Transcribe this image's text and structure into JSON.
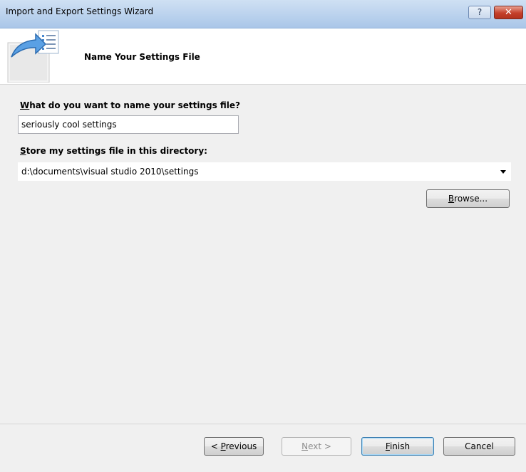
{
  "window": {
    "title": "Import and Export Settings Wizard",
    "help_label": "?",
    "close_label": "✕"
  },
  "header": {
    "heading": "Name Your Settings File"
  },
  "form": {
    "name_label_accel": "W",
    "name_label_rest": "hat do you want to name your settings file?",
    "name_value": "seriously cool settings",
    "dir_label_accel": "S",
    "dir_label_rest": "tore my settings file in this directory:",
    "dir_value": "d:\\documents\\visual studio 2010\\settings",
    "browse_accel": "B",
    "browse_rest": "rowse..."
  },
  "footer": {
    "prev_pre": "< ",
    "prev_accel": "P",
    "prev_rest": "revious",
    "next_accel": "N",
    "next_rest": "ext >",
    "finish_accel": "F",
    "finish_rest": "inish",
    "cancel_label": "Cancel"
  }
}
